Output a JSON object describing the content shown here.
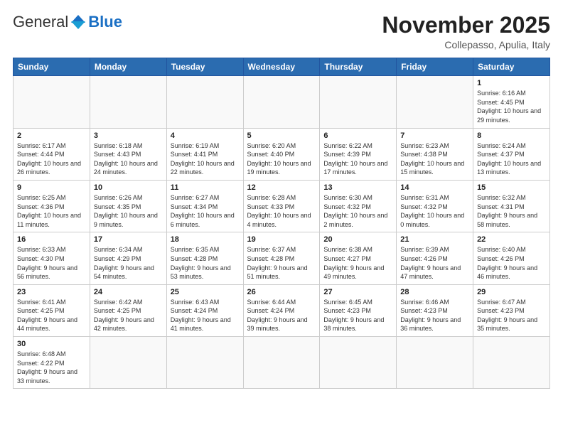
{
  "header": {
    "logo_general": "General",
    "logo_blue": "Blue",
    "month_title": "November 2025",
    "subtitle": "Collepasso, Apulia, Italy"
  },
  "days_of_week": [
    "Sunday",
    "Monday",
    "Tuesday",
    "Wednesday",
    "Thursday",
    "Friday",
    "Saturday"
  ],
  "weeks": [
    [
      {
        "day": "",
        "info": ""
      },
      {
        "day": "",
        "info": ""
      },
      {
        "day": "",
        "info": ""
      },
      {
        "day": "",
        "info": ""
      },
      {
        "day": "",
        "info": ""
      },
      {
        "day": "",
        "info": ""
      },
      {
        "day": "1",
        "info": "Sunrise: 6:16 AM\nSunset: 4:45 PM\nDaylight: 10 hours and 29 minutes."
      }
    ],
    [
      {
        "day": "2",
        "info": "Sunrise: 6:17 AM\nSunset: 4:44 PM\nDaylight: 10 hours and 26 minutes."
      },
      {
        "day": "3",
        "info": "Sunrise: 6:18 AM\nSunset: 4:43 PM\nDaylight: 10 hours and 24 minutes."
      },
      {
        "day": "4",
        "info": "Sunrise: 6:19 AM\nSunset: 4:41 PM\nDaylight: 10 hours and 22 minutes."
      },
      {
        "day": "5",
        "info": "Sunrise: 6:20 AM\nSunset: 4:40 PM\nDaylight: 10 hours and 19 minutes."
      },
      {
        "day": "6",
        "info": "Sunrise: 6:22 AM\nSunset: 4:39 PM\nDaylight: 10 hours and 17 minutes."
      },
      {
        "day": "7",
        "info": "Sunrise: 6:23 AM\nSunset: 4:38 PM\nDaylight: 10 hours and 15 minutes."
      },
      {
        "day": "8",
        "info": "Sunrise: 6:24 AM\nSunset: 4:37 PM\nDaylight: 10 hours and 13 minutes."
      }
    ],
    [
      {
        "day": "9",
        "info": "Sunrise: 6:25 AM\nSunset: 4:36 PM\nDaylight: 10 hours and 11 minutes."
      },
      {
        "day": "10",
        "info": "Sunrise: 6:26 AM\nSunset: 4:35 PM\nDaylight: 10 hours and 9 minutes."
      },
      {
        "day": "11",
        "info": "Sunrise: 6:27 AM\nSunset: 4:34 PM\nDaylight: 10 hours and 6 minutes."
      },
      {
        "day": "12",
        "info": "Sunrise: 6:28 AM\nSunset: 4:33 PM\nDaylight: 10 hours and 4 minutes."
      },
      {
        "day": "13",
        "info": "Sunrise: 6:30 AM\nSunset: 4:32 PM\nDaylight: 10 hours and 2 minutes."
      },
      {
        "day": "14",
        "info": "Sunrise: 6:31 AM\nSunset: 4:32 PM\nDaylight: 10 hours and 0 minutes."
      },
      {
        "day": "15",
        "info": "Sunrise: 6:32 AM\nSunset: 4:31 PM\nDaylight: 9 hours and 58 minutes."
      }
    ],
    [
      {
        "day": "16",
        "info": "Sunrise: 6:33 AM\nSunset: 4:30 PM\nDaylight: 9 hours and 56 minutes."
      },
      {
        "day": "17",
        "info": "Sunrise: 6:34 AM\nSunset: 4:29 PM\nDaylight: 9 hours and 54 minutes."
      },
      {
        "day": "18",
        "info": "Sunrise: 6:35 AM\nSunset: 4:28 PM\nDaylight: 9 hours and 53 minutes."
      },
      {
        "day": "19",
        "info": "Sunrise: 6:37 AM\nSunset: 4:28 PM\nDaylight: 9 hours and 51 minutes."
      },
      {
        "day": "20",
        "info": "Sunrise: 6:38 AM\nSunset: 4:27 PM\nDaylight: 9 hours and 49 minutes."
      },
      {
        "day": "21",
        "info": "Sunrise: 6:39 AM\nSunset: 4:26 PM\nDaylight: 9 hours and 47 minutes."
      },
      {
        "day": "22",
        "info": "Sunrise: 6:40 AM\nSunset: 4:26 PM\nDaylight: 9 hours and 46 minutes."
      }
    ],
    [
      {
        "day": "23",
        "info": "Sunrise: 6:41 AM\nSunset: 4:25 PM\nDaylight: 9 hours and 44 minutes."
      },
      {
        "day": "24",
        "info": "Sunrise: 6:42 AM\nSunset: 4:25 PM\nDaylight: 9 hours and 42 minutes."
      },
      {
        "day": "25",
        "info": "Sunrise: 6:43 AM\nSunset: 4:24 PM\nDaylight: 9 hours and 41 minutes."
      },
      {
        "day": "26",
        "info": "Sunrise: 6:44 AM\nSunset: 4:24 PM\nDaylight: 9 hours and 39 minutes."
      },
      {
        "day": "27",
        "info": "Sunrise: 6:45 AM\nSunset: 4:23 PM\nDaylight: 9 hours and 38 minutes."
      },
      {
        "day": "28",
        "info": "Sunrise: 6:46 AM\nSunset: 4:23 PM\nDaylight: 9 hours and 36 minutes."
      },
      {
        "day": "29",
        "info": "Sunrise: 6:47 AM\nSunset: 4:23 PM\nDaylight: 9 hours and 35 minutes."
      }
    ],
    [
      {
        "day": "30",
        "info": "Sunrise: 6:48 AM\nSunset: 4:22 PM\nDaylight: 9 hours and 33 minutes."
      },
      {
        "day": "",
        "info": ""
      },
      {
        "day": "",
        "info": ""
      },
      {
        "day": "",
        "info": ""
      },
      {
        "day": "",
        "info": ""
      },
      {
        "day": "",
        "info": ""
      },
      {
        "day": "",
        "info": ""
      }
    ]
  ]
}
